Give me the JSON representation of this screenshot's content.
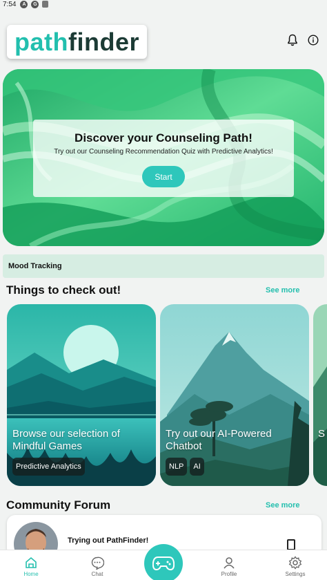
{
  "status_bar": {
    "time": "7:54",
    "icons": [
      "android-icon",
      "google-icon",
      "sim-icon"
    ]
  },
  "header": {
    "logo_part1": "path",
    "logo_part2": "finder",
    "icons": [
      "bell-icon",
      "info-icon"
    ]
  },
  "hero": {
    "title": "Discover your Counseling Path!",
    "subtitle": "Try out our Counseling Recommendation Quiz with Predictive Analytics!",
    "button_label": "Start"
  },
  "mood": {
    "label": "Mood Tracking"
  },
  "things": {
    "title": "Things to check out!",
    "see_more": "See more",
    "cards": [
      {
        "title": "Browse our selection of Mindful Games",
        "tags": [
          "Predictive Analytics"
        ]
      },
      {
        "title": "Try out our AI-Powered Chatbot",
        "tags": [
          "NLP",
          "AI"
        ]
      },
      {
        "title": "S"
      }
    ]
  },
  "community": {
    "title": "Community Forum",
    "see_more": "See more",
    "posts": [
      {
        "title": "Trying out PathFinder!"
      }
    ]
  },
  "nav": {
    "items": [
      {
        "label": "Home",
        "icon": "home-icon",
        "active": true
      },
      {
        "label": "Chat",
        "icon": "chat-icon",
        "active": false
      },
      {
        "label": "Profile",
        "icon": "profile-icon",
        "active": false
      },
      {
        "label": "Settings",
        "icon": "settings-icon",
        "active": false
      }
    ],
    "center_icon": "gamepad-icon"
  },
  "colors": {
    "accent": "#2ec7bb",
    "accent_text": "#24bfae",
    "mood_bg": "#d6ede2",
    "logo_dark": "#1c3b35"
  }
}
